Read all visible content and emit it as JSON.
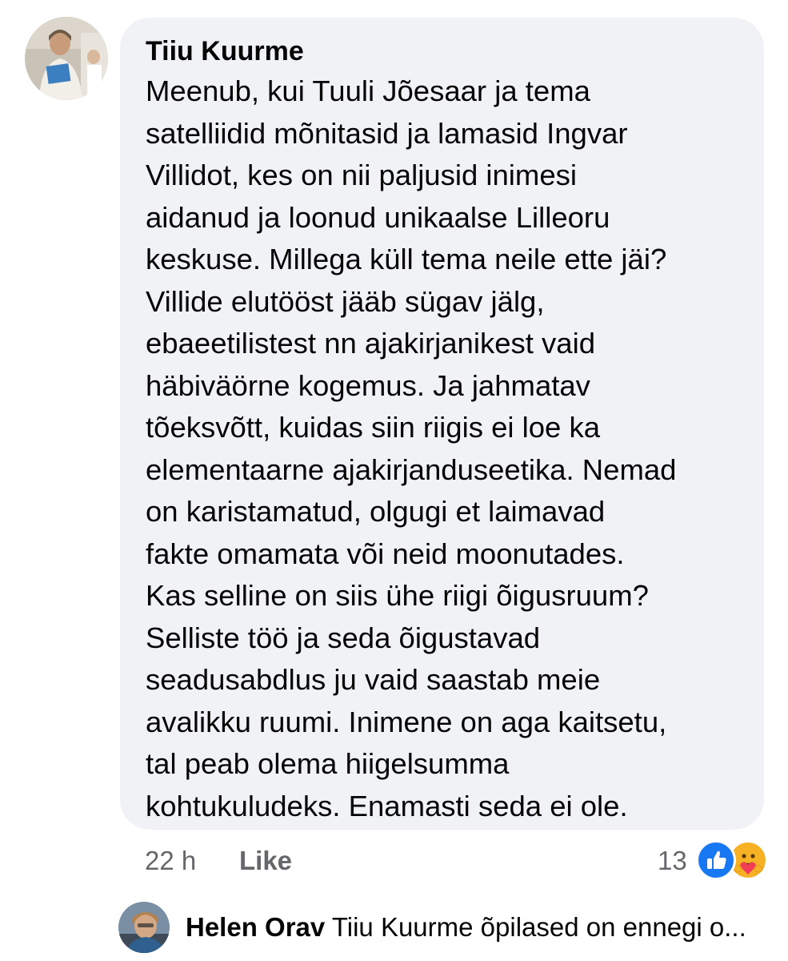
{
  "comment": {
    "author": "Tiiu Kuurme",
    "text": "Meenub, kui Tuuli Jõesaar ja tema\nsatelliidid mõnitasid ja lamasid Ingvar\nVillidot, kes on nii paljusid inimesi\naidanud ja loonud unikaalse Lilleoru\nkeskuse. Millega küll tema neile ette jäi?\nVillide elutööst jääb sügav jälg,\nebaeetilistest nn ajakirjanikest vaid\nhäbiväörne kogemus. Ja jahmatav\ntõeksvõtt, kuidas siin riigis ei loe ka\nelementaarne ajakirjanduseetika. Nemad\non karistamatud, olgugi et laimavad\nfakte omamata või neid moonutades.\nKas selline on siis ühe riigi õigusruum?\nSelliste töö ja seda õigustavad\nseadusabdlus ju vaid saastab meie\navalikku ruumi. Inimene on aga kaitsetu,\ntal peab olema hiigelsumma\nkohtukuludeks. Enamasti seda ei ole.",
    "time": "22 h",
    "like_label": "Like",
    "reaction_count": "13",
    "reactions": [
      "like-icon",
      "care-icon"
    ]
  },
  "reply": {
    "author": "Helen Orav",
    "text": "Tiiu Kuurme õpilased on ennegi o..."
  },
  "colors": {
    "bubble": "#f0f2f5",
    "meta_text": "#65676b",
    "like_blue": "#1877f2",
    "care_yellow": "#f7b125"
  }
}
